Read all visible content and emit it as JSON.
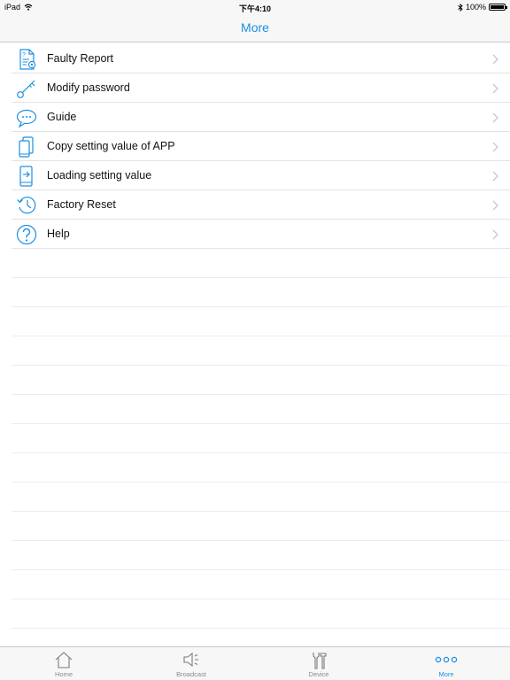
{
  "status_bar": {
    "device": "iPad",
    "time": "下午4:10",
    "battery": "100%",
    "battery_level": 1.0
  },
  "nav": {
    "title": "More"
  },
  "menu": {
    "items": [
      {
        "label": "Faulty Report",
        "icon": "report-icon"
      },
      {
        "label": "Modify password",
        "icon": "key-icon"
      },
      {
        "label": "Guide",
        "icon": "chat-bubble-icon"
      },
      {
        "label": "Copy setting value of APP",
        "icon": "copy-devices-icon"
      },
      {
        "label": "Loading setting value",
        "icon": "load-device-icon"
      },
      {
        "label": "Factory Reset",
        "icon": "reset-clock-icon"
      },
      {
        "label": "Help",
        "icon": "help-icon"
      }
    ]
  },
  "tabs": [
    {
      "label": "Home",
      "icon": "home-icon"
    },
    {
      "label": "Broadcast",
      "icon": "speaker-icon"
    },
    {
      "label": "Device",
      "icon": "tools-icon"
    },
    {
      "label": "More",
      "icon": "more-dots-icon",
      "active": true
    }
  ],
  "colors": {
    "accent": "#1d8fe0",
    "tab_inactive": "#8a8a8a",
    "separator": "#e3e3e6"
  }
}
